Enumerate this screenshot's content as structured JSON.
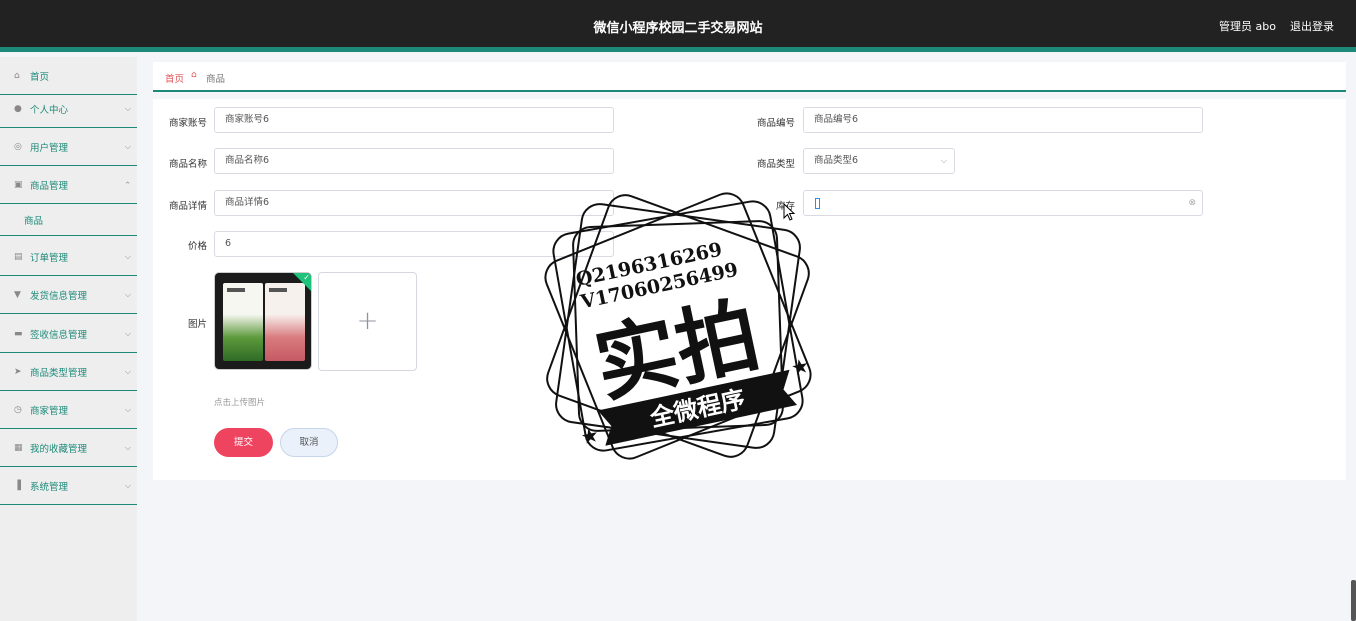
{
  "header": {
    "title": "微信小程序校园二手交易网站",
    "user": "管理员 abo",
    "logout": "退出登录"
  },
  "sidebar": {
    "items": [
      {
        "label": "首页",
        "icon": "home-icon"
      },
      {
        "label": "个人中心",
        "icon": "user-icon"
      },
      {
        "label": "用户管理",
        "icon": "user-manage-icon"
      },
      {
        "label": "商品管理",
        "icon": "goods-icon",
        "expanded": true
      },
      {
        "label": "订单管理",
        "icon": "order-icon"
      },
      {
        "label": "发货信息管理",
        "icon": "ship-icon"
      },
      {
        "label": "签收信息管理",
        "icon": "sign-icon"
      },
      {
        "label": "商品类型管理",
        "icon": "send-icon"
      },
      {
        "label": "商家管理",
        "icon": "clock-icon"
      },
      {
        "label": "我的收藏管理",
        "icon": "favorite-icon"
      },
      {
        "label": "系统管理",
        "icon": "system-icon"
      }
    ],
    "sub_item": "商品"
  },
  "breadcrumb": {
    "home": "首页",
    "current": "商品"
  },
  "form": {
    "merchant_account_label": "商家账号",
    "merchant_account_value": "商家账号6",
    "goods_no_label": "商品编号",
    "goods_no_value": "商品编号6",
    "goods_name_label": "商品名称",
    "goods_name_value": "商品名称6",
    "goods_type_label": "商品类型",
    "goods_type_value": "商品类型6",
    "goods_detail_label": "商品详情",
    "goods_detail_value": "商品详情6",
    "stock_label": "库存",
    "stock_value": "",
    "price_label": "价格",
    "price_value": "6",
    "image_label": "图片",
    "upload_tip": "点击上传图片",
    "submit": "提交",
    "cancel": "取消"
  },
  "watermark": {
    "line1": "Q2196316269",
    "line2": "V17060256499",
    "main": "实拍",
    "banner": "全微程序"
  },
  "colors": {
    "accent": "#1d8a79",
    "danger": "#ef4460"
  }
}
